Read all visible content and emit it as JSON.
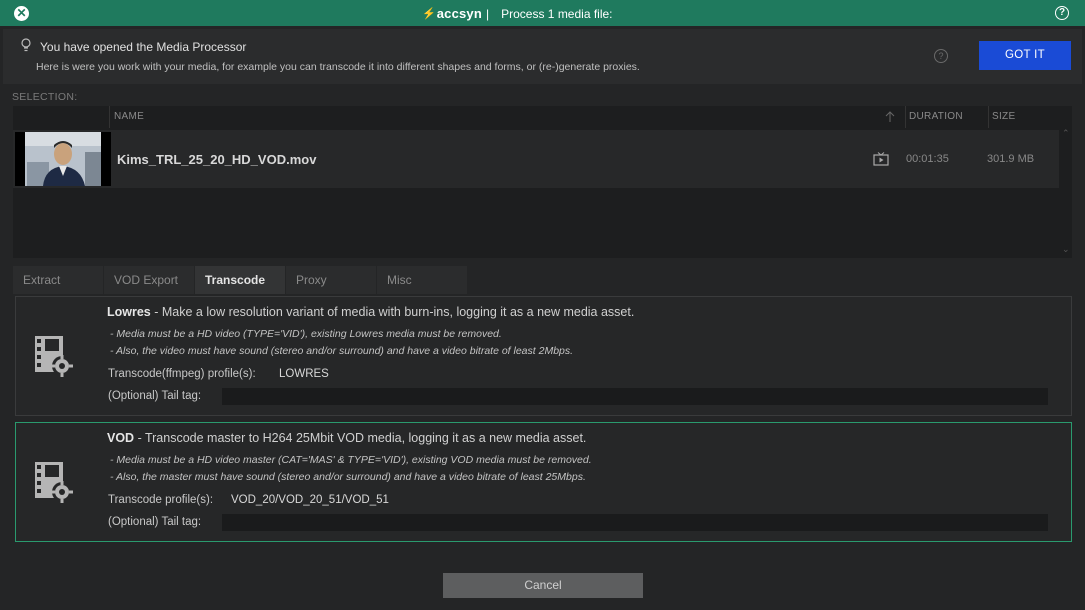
{
  "titlebar": {
    "brand": "accsyn",
    "separator": "|",
    "title": "Process 1 media file:",
    "help_glyph": "?"
  },
  "info": {
    "title": "You have opened the Media Processor",
    "text": "Here is were you work with your media, for example you can transcode it into different shapes and forms, or (re-)generate proxies.",
    "help_glyph": "?",
    "button_label": "GOT IT"
  },
  "selection": {
    "label": "SELECTION:",
    "columns": {
      "name": "NAME",
      "duration": "DURATION",
      "size": "SIZE"
    },
    "rows": [
      {
        "name": "Kims_TRL_25_20_HD_VOD.mov",
        "duration": "00:01:35",
        "size": "301.9 MB"
      }
    ]
  },
  "tabs": [
    "Extract",
    "VOD Export",
    "Transcode",
    "Proxy",
    "Misc"
  ],
  "active_tab": "Transcode",
  "actions": [
    {
      "name": "Lowres",
      "description": " - Make a low resolution variant of media with burn-ins, logging it as a new media asset.",
      "notes": [
        "- Media must be a HD video (TYPE='VID'), existing Lowres media must be removed.",
        "- Also, the video must have sound (stereo and/or surround) and have a video bitrate of least 2Mbps."
      ],
      "profile_label": "Transcode(ffmpeg) profile(s):",
      "profile_value": "LOWRES",
      "tail_label": "(Optional) Tail tag:",
      "tail_value": ""
    },
    {
      "name": "VOD",
      "description": " - Transcode master to H264 25Mbit VOD media, logging it as a new media asset.",
      "notes": [
        "- Media must be a HD video master (CAT='MAS' & TYPE='VID'), existing VOD media must be removed.",
        "- Also, the master must have sound (stereo and/or surround) and have a video bitrate of least 25Mbps."
      ],
      "profile_label": "Transcode profile(s):",
      "profile_value": "VOD_20/VOD_20_51/VOD_51",
      "tail_label": "(Optional) Tail tag:",
      "tail_value": ""
    }
  ],
  "cancel_label": "Cancel",
  "colors": {
    "accent_green": "#1f7a5e",
    "primary_blue": "#1a4bd6",
    "selected_border": "#2a9a6e"
  }
}
